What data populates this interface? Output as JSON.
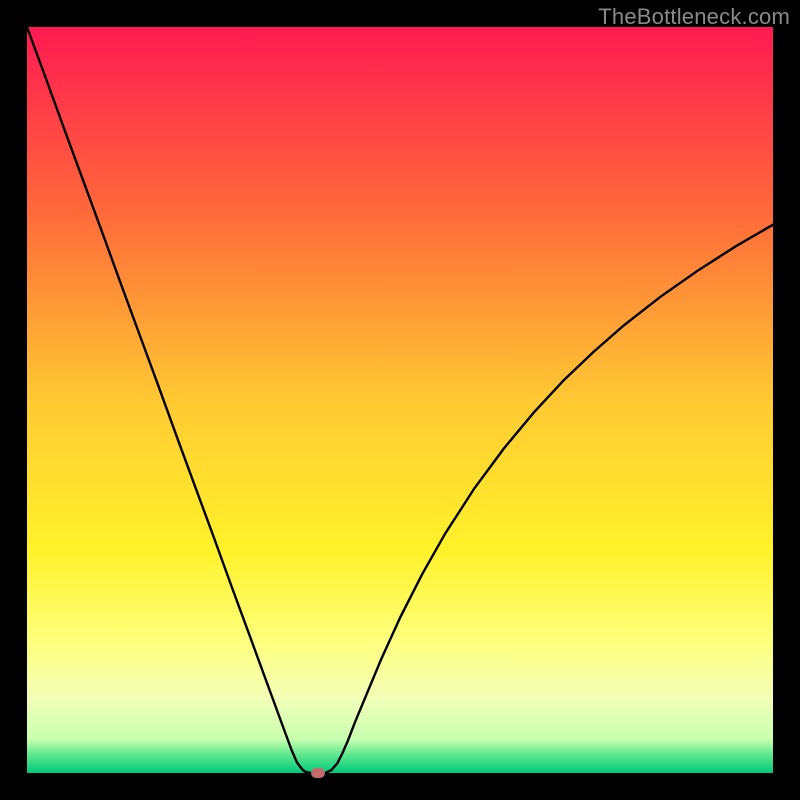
{
  "watermark": "TheBottleneck.com",
  "chart_data": {
    "type": "line",
    "title": "",
    "xlabel": "",
    "ylabel": "",
    "xlim": [
      0,
      100
    ],
    "ylim": [
      0,
      100
    ],
    "grid": false,
    "background": "rainbow-gradient",
    "gradient_stops": [
      {
        "pos": 0.0,
        "color": "#ff1a52"
      },
      {
        "pos": 0.25,
        "color": "#ff6a3a"
      },
      {
        "pos": 0.5,
        "color": "#ffc933"
      },
      {
        "pos": 0.7,
        "color": "#fff22a"
      },
      {
        "pos": 0.82,
        "color": "#fdff7a"
      },
      {
        "pos": 0.9,
        "color": "#f3ffb8"
      },
      {
        "pos": 0.955,
        "color": "#c8ffb0"
      },
      {
        "pos": 0.975,
        "color": "#61e890"
      },
      {
        "pos": 1.0,
        "color": "#00c97a"
      }
    ],
    "series": [
      {
        "name": "bottleneck-curve",
        "color": "#000000",
        "x": [
          0.0,
          2.5,
          5.0,
          7.5,
          10.0,
          12.5,
          15.0,
          17.5,
          20.0,
          22.5,
          25.0,
          27.5,
          30.0,
          31.5,
          33.0,
          34.5,
          35.5,
          36.2,
          36.8,
          37.2,
          38.0,
          39.0,
          40.0,
          40.8,
          41.6,
          42.3,
          43.0,
          44.0,
          45.5,
          47.5,
          50.0,
          53.0,
          56.0,
          60.0,
          64.0,
          68.0,
          72.0,
          76.0,
          80.0,
          85.0,
          90.0,
          95.0,
          100.0
        ],
        "y": [
          100.0,
          93.2,
          86.3,
          79.5,
          72.7,
          65.8,
          59.0,
          52.2,
          45.3,
          38.5,
          31.7,
          24.8,
          18.0,
          13.9,
          9.8,
          5.7,
          3.0,
          1.4,
          0.6,
          0.2,
          0.0,
          0.0,
          0.0,
          0.4,
          1.3,
          2.7,
          4.3,
          6.9,
          10.5,
          15.3,
          20.8,
          26.7,
          32.0,
          38.2,
          43.6,
          48.4,
          52.7,
          56.5,
          60.0,
          63.9,
          67.4,
          70.6,
          73.5
        ]
      }
    ],
    "marker": {
      "x": 39.0,
      "y": 0.0,
      "color": "#c66b6b"
    }
  }
}
